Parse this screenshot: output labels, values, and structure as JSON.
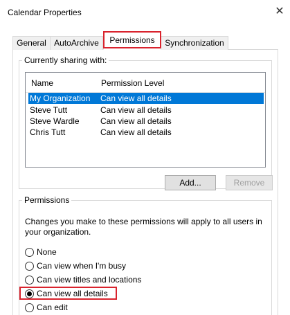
{
  "window": {
    "title": "Calendar Properties",
    "close_glyph": "✕"
  },
  "tabs": [
    {
      "label": "General"
    },
    {
      "label": "AutoArchive"
    },
    {
      "label": "Permissions"
    },
    {
      "label": "Synchronization"
    }
  ],
  "sharing": {
    "legend": "Currently sharing with:",
    "columns": {
      "name": "Name",
      "level": "Permission Level"
    },
    "rows": [
      {
        "name": "My Organization",
        "level": "Can view all details",
        "selected": true
      },
      {
        "name": "Steve Tutt",
        "level": "Can view all details"
      },
      {
        "name": "Steve Wardle",
        "level": "Can view all details"
      },
      {
        "name": "Chris Tutt",
        "level": "Can view all details"
      }
    ],
    "add_label": "Add...",
    "remove_label": "Remove"
  },
  "permissions": {
    "legend": "Permissions",
    "note": "Changes you make to these permissions will apply to all users in your organization.",
    "options": [
      {
        "label": "None",
        "checked": false
      },
      {
        "label": "Can view when I'm busy",
        "checked": false
      },
      {
        "label": "Can view titles and locations",
        "checked": false
      },
      {
        "label": "Can view all details",
        "checked": true
      },
      {
        "label": "Can edit",
        "checked": false
      }
    ]
  },
  "colors": {
    "highlight": "#d9232d",
    "selection": "#0078d7"
  }
}
